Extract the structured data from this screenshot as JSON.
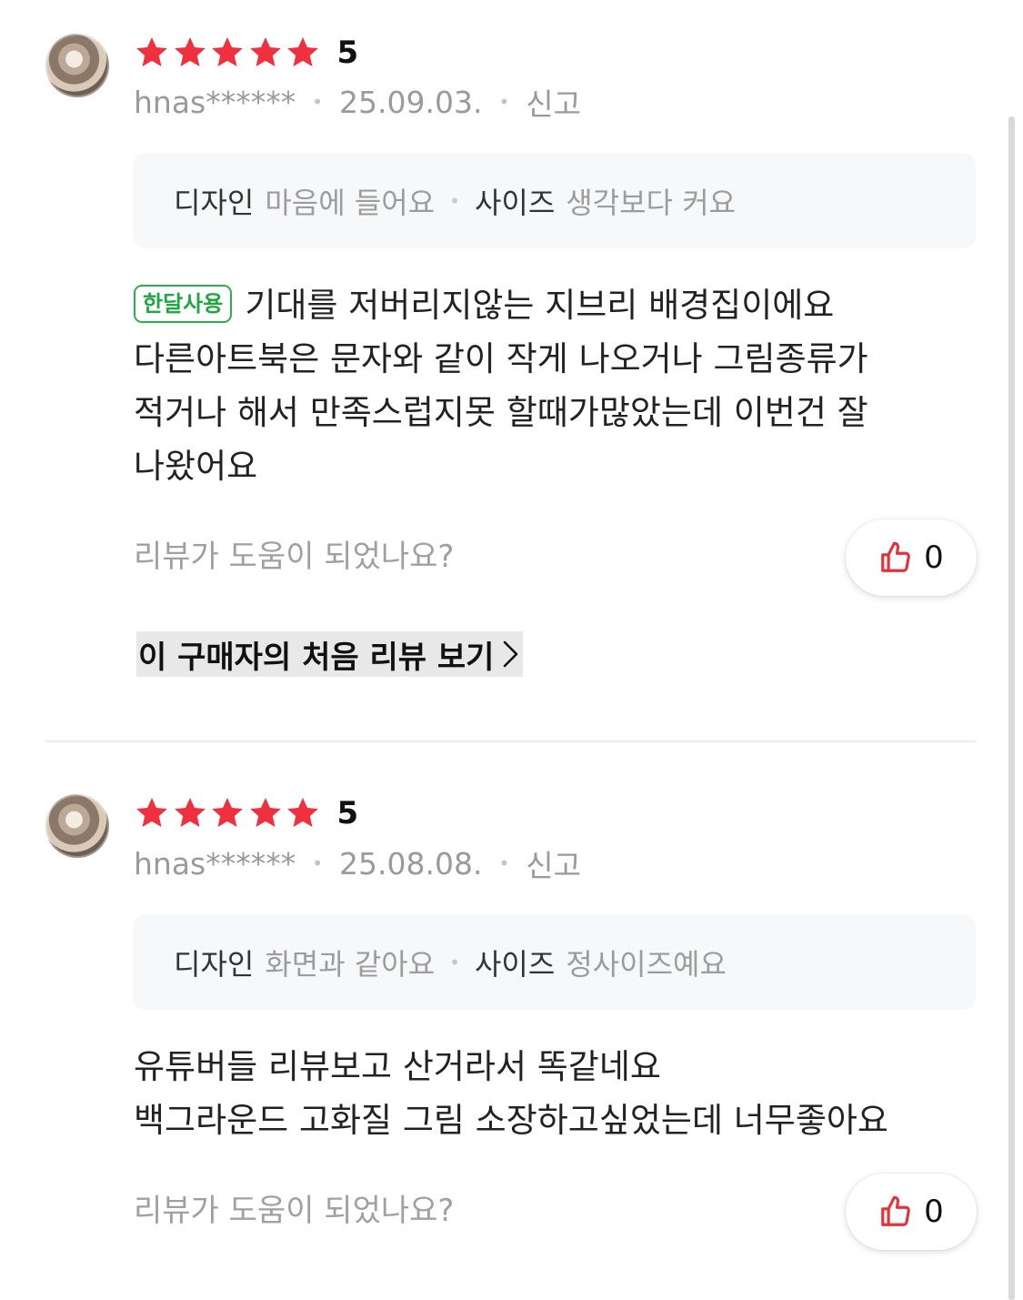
{
  "colors": {
    "star": "#f0303f",
    "badge_green": "#1fa842",
    "thumb_red": "#e8303a",
    "meta_gray": "#9a9a9a"
  },
  "reviews": [
    {
      "rating_stars": 5,
      "score": "5",
      "user": "hnas******",
      "date": "25.09.03.",
      "report": "신고",
      "options": [
        {
          "label": "디자인",
          "value": "마음에 들어요"
        },
        {
          "label": "사이즈",
          "value": "생각보다 커요"
        }
      ],
      "badge": "한달사용",
      "body_lines": [
        "기대를 저버리지않는 지브리 배경집이에요",
        "다른아트북은 문자와 같이 작게 나오거나 그림종류가",
        "적거나 해서 만족스럽지못 할때가많았는데 이번건 잘",
        "나왔어요"
      ],
      "helpful_question": "리뷰가 도움이 되었나요?",
      "like_count": "0",
      "first_review_link": "이 구매자의 처음 리뷰 보기"
    },
    {
      "rating_stars": 5,
      "score": "5",
      "user": "hnas******",
      "date": "25.08.08.",
      "report": "신고",
      "options": [
        {
          "label": "디자인",
          "value": "화면과 같아요"
        },
        {
          "label": "사이즈",
          "value": "정사이즈예요"
        }
      ],
      "body_lines": [
        "유튜버들 리뷰보고 산거라서 똑같네요",
        "백그라운드 고화질 그림 소장하고싶었는데 너무좋아요"
      ],
      "helpful_question": "리뷰가 도움이 되었나요?",
      "like_count": "0"
    }
  ],
  "icons": {
    "star": "star-icon",
    "thumb": "thumbs-up-icon",
    "chevron": "chevron-right-icon"
  }
}
